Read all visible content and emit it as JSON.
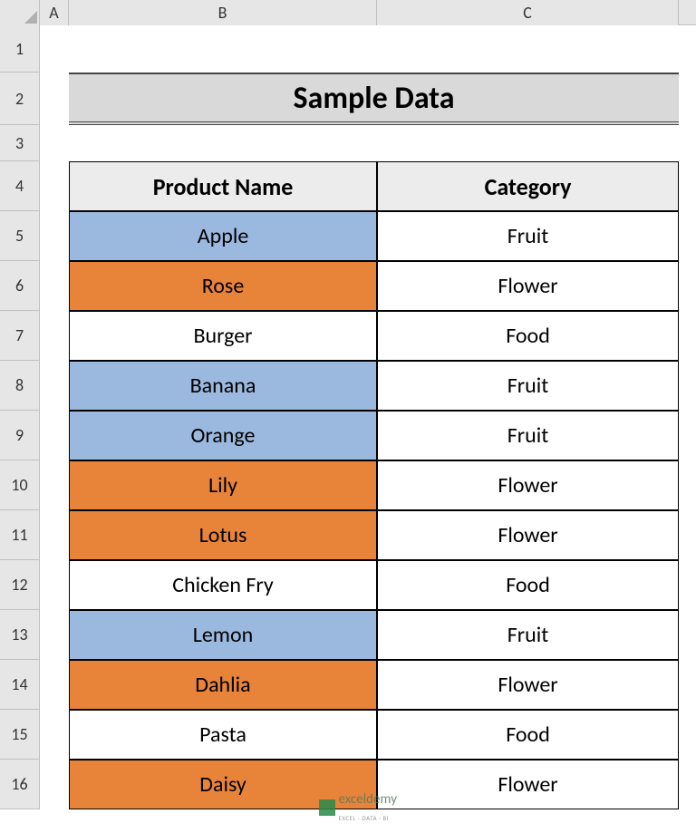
{
  "columns": {
    "A": "A",
    "B": "B",
    "C": "C"
  },
  "rows": [
    "1",
    "2",
    "3",
    "4",
    "5",
    "6",
    "7",
    "8",
    "9",
    "10",
    "11",
    "12",
    "13",
    "14",
    "15",
    "16"
  ],
  "title": "Sample Data",
  "table_headers": {
    "product": "Product Name",
    "category": "Category"
  },
  "data": [
    {
      "product": "Apple",
      "category": "Fruit",
      "fill": "blue"
    },
    {
      "product": "Rose",
      "category": "Flower",
      "fill": "orange"
    },
    {
      "product": "Burger",
      "category": "Food",
      "fill": "none"
    },
    {
      "product": "Banana",
      "category": "Fruit",
      "fill": "blue"
    },
    {
      "product": "Orange",
      "category": "Fruit",
      "fill": "blue"
    },
    {
      "product": "Lily",
      "category": "Flower",
      "fill": "orange"
    },
    {
      "product": "Lotus",
      "category": "Flower",
      "fill": "orange"
    },
    {
      "product": "Chicken Fry",
      "category": "Food",
      "fill": "none"
    },
    {
      "product": "Lemon",
      "category": "Fruit",
      "fill": "blue"
    },
    {
      "product": "Dahlia",
      "category": "Flower",
      "fill": "orange"
    },
    {
      "product": "Pasta",
      "category": "Food",
      "fill": "none"
    },
    {
      "product": "Daisy",
      "category": "Flower",
      "fill": "orange"
    }
  ],
  "watermark": {
    "brand": "exceldemy",
    "tagline": "EXCEL · DATA · BI"
  }
}
